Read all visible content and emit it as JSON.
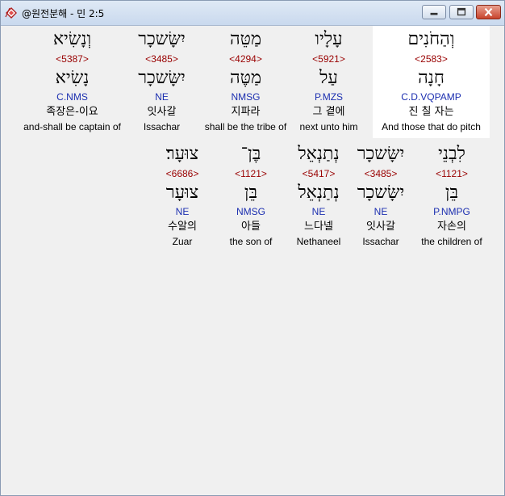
{
  "window": {
    "title": "@원전분해 - 민 2:5",
    "minimize_label": "",
    "maximize_label": "",
    "close_label": ""
  },
  "rows": [
    {
      "words": [
        {
          "hebrew": "וְהַחֹנִים",
          "strong": "<2583>",
          "lemma": "חָנָה",
          "morph": "C.D.VQPAMP",
          "korean": "진 칠 자는",
          "english": "And those that do pitch",
          "highlighted": true
        },
        {
          "hebrew": "עָלָיו",
          "strong": "<5921>",
          "lemma": "עַל",
          "morph": "P.MZS",
          "korean": "그 곁에",
          "english": "next unto him",
          "highlighted": false
        },
        {
          "hebrew": "מַטֵּה",
          "strong": "<4294>",
          "lemma": "מַטֶּה",
          "morph": "NMSG",
          "korean": "지파라",
          "english": "shall be the tribe of",
          "highlighted": false
        },
        {
          "hebrew": "יִשָּׂשכָר",
          "strong": "<3485>",
          "lemma": "יִשָּׂשכָר",
          "morph": "NE",
          "korean": "잇사갈",
          "english": "Issachar",
          "highlighted": false
        },
        {
          "hebrew": "וְנָשִׂיא",
          "strong": "<5387>",
          "lemma": "נָשִׂיא",
          "morph": "C.NMS",
          "korean": "족장은-이요",
          "english": "and-shall be captain of",
          "highlighted": false
        }
      ]
    },
    {
      "words": [
        {
          "hebrew": "לִבְנֵי",
          "strong": "<1121>",
          "lemma": "בֵּן",
          "morph": "P.NMPG",
          "korean": "자손의",
          "english": "the children of",
          "highlighted": false
        },
        {
          "hebrew": "יִשָּׂשכָר",
          "strong": "<3485>",
          "lemma": "יִשָּׂשכָר",
          "morph": "NE",
          "korean": "잇사갈",
          "english": "Issachar",
          "highlighted": false
        },
        {
          "hebrew": "נְתַנְאֵל",
          "strong": "<5417>",
          "lemma": "נְתַנְאֵל",
          "morph": "NE",
          "korean": "느다넬",
          "english": "Nethaneel",
          "highlighted": false
        },
        {
          "hebrew": "בֶּן־",
          "strong": "<1121>",
          "lemma": "בֵּן",
          "morph": "NMSG",
          "korean": "아들",
          "english": "the son of",
          "highlighted": false
        },
        {
          "hebrew": "צוּעָר׃",
          "strong": "<6686>",
          "lemma": "צוּעָר",
          "morph": "NE",
          "korean": "수알의",
          "english": "Zuar",
          "highlighted": false
        }
      ]
    }
  ]
}
